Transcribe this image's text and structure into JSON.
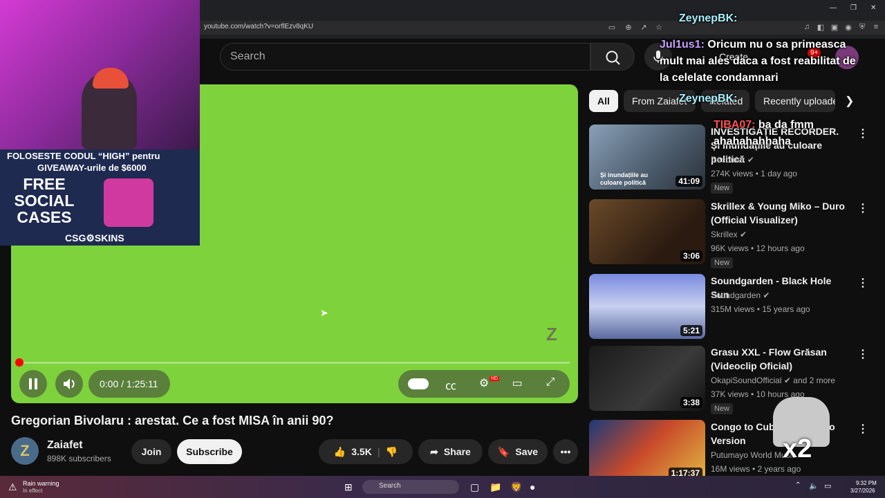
{
  "browser": {
    "url": "youtube.com/watch?v=orflEzv8qKU"
  },
  "header": {
    "search_placeholder": "Search",
    "create_label": "Create",
    "notification_count": "9+"
  },
  "player": {
    "time": "0:00 / 1:25:11",
    "hd_badge": "HD",
    "progress_fraction": 0.0
  },
  "video": {
    "title": "Gregorian Bivolaru : arestat. Ce a fost MISA în anii 90?",
    "channel_name": "Zaiafet",
    "subscribers": "898K subscribers",
    "join_label": "Join",
    "subscribe_label": "Subscribe",
    "likes": "3.5K",
    "share_label": "Share",
    "save_label": "Save"
  },
  "chips": [
    "All",
    "From Zaiafet",
    "Related",
    "Recently uploaded"
  ],
  "related": [
    {
      "title": "INVESTIGAȚIE RECORDER. Și inundațiile au culoare politică",
      "channel": "Recorder",
      "meta": "274K views • 1 day ago",
      "badge": "New",
      "duration": "41:09",
      "thumb_caption": "Și inundațiile au culoare politică"
    },
    {
      "title": "Skrillex & Young Miko – Duro (Official Visualizer)",
      "channel": "Skrillex",
      "meta": "96K views • 12 hours ago",
      "badge": "New",
      "duration": "3:06"
    },
    {
      "title": "Soundgarden - Black Hole Sun",
      "channel": "Soundgarden",
      "meta": "315M views • 15 years ago",
      "duration": "5:21"
    },
    {
      "title": "Grasu XXL - Flow Grăsan (Videoclip Oficial)",
      "channel": "OkapiSoundOfficial",
      "channel_extra": "and 2 more",
      "meta": "37K views • 10 hours ago",
      "badge": "New",
      "duration": "3:38"
    },
    {
      "title": "Congo to Cuba | Putumayo Version",
      "channel": "Putumayo World Music",
      "meta": "16M views • 2 years ago",
      "duration": "1:17:37"
    }
  ],
  "overlay": {
    "ad_line1": "FOLOSESTE CODUL “HIGH” pentru",
    "ad_line2": "GIVEAWAY-urile de $6000",
    "ad_free": "FREE SOCIAL CASES",
    "ad_brand": "CSG⚙SKINS",
    "chat": [
      {
        "user": "ZeynepBK:",
        "text": ""
      },
      {
        "user": "Jul1us1:",
        "text": "Oricum nu o sa primeasca mult mai ales daca a fost reabilitat de la celelate condamnari"
      },
      {
        "user": "ZeynepBK:",
        "text": ""
      },
      {
        "user": "TIBA07:",
        "text": "ba da fmm ahahahahhaha"
      }
    ],
    "multiplier": "x2"
  },
  "taskbar": {
    "weather_title": "Rain warning",
    "weather_sub": "In effect",
    "search_label": "Search",
    "time": "9:32 PM",
    "date": "3/27/2026"
  },
  "colors": {
    "player_bg": "#7ed23c",
    "accent_red": "#ff0000",
    "background": "#0f0f0f"
  }
}
